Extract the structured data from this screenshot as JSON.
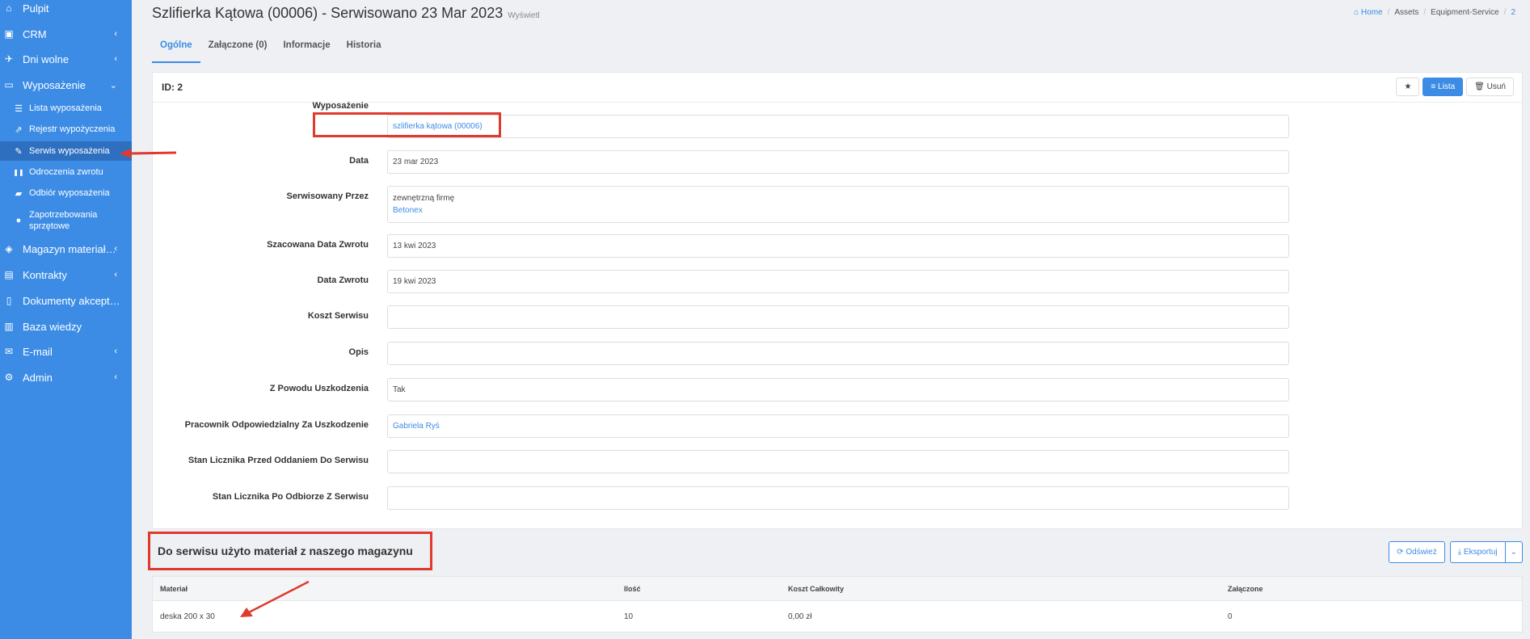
{
  "sidebar": {
    "items": [
      {
        "label": "Pulpit",
        "icon": "home-icon",
        "glyph": "⌂"
      },
      {
        "label": "CRM",
        "icon": "id-card-icon",
        "glyph": "▣"
      },
      {
        "label": "Dni wolne",
        "icon": "plane-icon",
        "glyph": "✈"
      },
      {
        "label": "Wyposażenie",
        "icon": "hdd-icon",
        "glyph": "▭"
      }
    ],
    "sub_items": [
      {
        "label": "Lista wyposażenia",
        "icon": "list-icon",
        "glyph": "☰"
      },
      {
        "label": "Rejestr wypożyczenia",
        "icon": "external-link-icon",
        "glyph": "⇗"
      },
      {
        "label": "Serwis wyposażenia",
        "icon": "wrench-icon",
        "glyph": "✎"
      },
      {
        "label": "Odroczenia zwrotu",
        "icon": "pause-icon",
        "glyph": "❚❚"
      },
      {
        "label": "Odbiór wyposażenia",
        "icon": "truck-icon",
        "glyph": "▰"
      },
      {
        "label": "Zapotrzebowania",
        "label2": "sprzętowe",
        "icon": "download-circle-icon",
        "glyph": "●"
      }
    ],
    "bottom_items": [
      {
        "label": "Magazyn materiał…",
        "icon": "cubes-icon",
        "glyph": "◈"
      },
      {
        "label": "Kontrakty",
        "icon": "briefcase-icon",
        "glyph": "▤"
      },
      {
        "label": "Dokumenty akcept…",
        "icon": "file-icon",
        "glyph": "▯"
      },
      {
        "label": "Baza wiedzy",
        "icon": "book-icon",
        "glyph": "▥"
      },
      {
        "label": "E-mail",
        "icon": "envelope-icon",
        "glyph": "✉"
      },
      {
        "label": "Admin",
        "icon": "cogs-icon",
        "glyph": "⚙"
      }
    ]
  },
  "header": {
    "title": "Szlifierka Kątowa (00006) - Serwisowano 23 Mar 2023",
    "subtitle": "Wyświetl",
    "breadcrumb": [
      "Home",
      "Assets",
      "Equipment-Service",
      "2"
    ]
  },
  "tabs": [
    "Ogólne",
    "Załączone (0)",
    "Informacje",
    "Historia"
  ],
  "card": {
    "id_label": "ID: 2",
    "buttons": {
      "star": "★",
      "list": "≡ Lista",
      "delete": "🗑 Usuń"
    },
    "fields": [
      {
        "label": "Wyposażenie",
        "value": "szlifierka kątowa (00006)",
        "link": true
      },
      {
        "label": "Data",
        "value": "23 mar 2023"
      },
      {
        "label": "Serwisowany Przez",
        "value": "zewnętrzną firmę",
        "value2": "Betonex"
      },
      {
        "label": "Szacowana Data Zwrotu",
        "value": "13 kwi 2023"
      },
      {
        "label": "Data Zwrotu",
        "value": "19 kwi 2023"
      },
      {
        "label": "Koszt Serwisu",
        "value": ""
      },
      {
        "label": "Opis",
        "value": ""
      },
      {
        "label": "Z Powodu Uszkodzenia",
        "value": "Tak"
      },
      {
        "label": "Pracownik Odpowiedzialny Za Uszkodzenie",
        "value": "Gabriela Ryś",
        "link": true
      },
      {
        "label": "Stan Licznika Przed Oddaniem Do Serwisu",
        "value": ""
      },
      {
        "label": "Stan Licznika Po Odbiorze Z Serwisu",
        "value": ""
      }
    ]
  },
  "materials": {
    "title": "Do serwisu użyto materiał z naszego magazynu",
    "refresh": "⟳ Odśwież",
    "export": "⤓ Eksportuj",
    "export_caret": "⌄",
    "columns": [
      "Materiał",
      "Ilość",
      "Koszt Całkowity",
      "Załączone"
    ],
    "rows": [
      {
        "material": "deska 200 x 30",
        "qty": "10",
        "cost": "0,00 zł",
        "attached": "0"
      }
    ]
  },
  "colors": {
    "sidebar": "#3c8ce6",
    "annotation": "#e03a2f"
  }
}
